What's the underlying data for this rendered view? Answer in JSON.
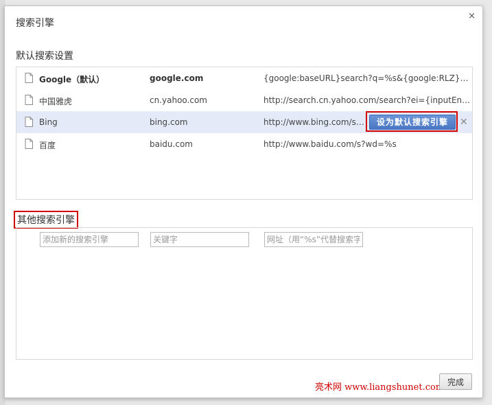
{
  "dialog": {
    "title": "搜索引擎",
    "close_glyph": "×"
  },
  "default_section": {
    "title": "默认搜索设置",
    "engines": [
      {
        "name": "Google（默认）",
        "keyword": "google.com",
        "url": "{google:baseURL}search?q=%s&{google:RLZ}{goo..."
      },
      {
        "name": "中国雅虎",
        "keyword": "cn.yahoo.com",
        "url": "http://search.cn.yahoo.com/search?ei={inputEnco..."
      },
      {
        "name": "Bing",
        "keyword": "bing.com",
        "url": "http://www.bing.com/sear..."
      },
      {
        "name": "百度",
        "keyword": "baidu.com",
        "url": "http://www.baidu.com/s?wd=%s"
      }
    ],
    "make_default_label": "设为默认搜索引擎",
    "remove_glyph": "✕"
  },
  "other_section": {
    "title": "其他搜索引擎",
    "new_engine_placeholder": "添加新的搜索引擎",
    "keyword_placeholder": "关键字",
    "url_placeholder": "网址（用“%s”代替搜索字词"
  },
  "watermark": "亮术网 www.liangshunet.com",
  "done_label": "完成",
  "icons": {
    "document": "document-icon",
    "close": "close-icon",
    "remove": "remove-icon"
  },
  "colors": {
    "selected_row": "#e4eaf7",
    "highlight_border": "#d10000",
    "button_blue": "#4a77c4"
  }
}
